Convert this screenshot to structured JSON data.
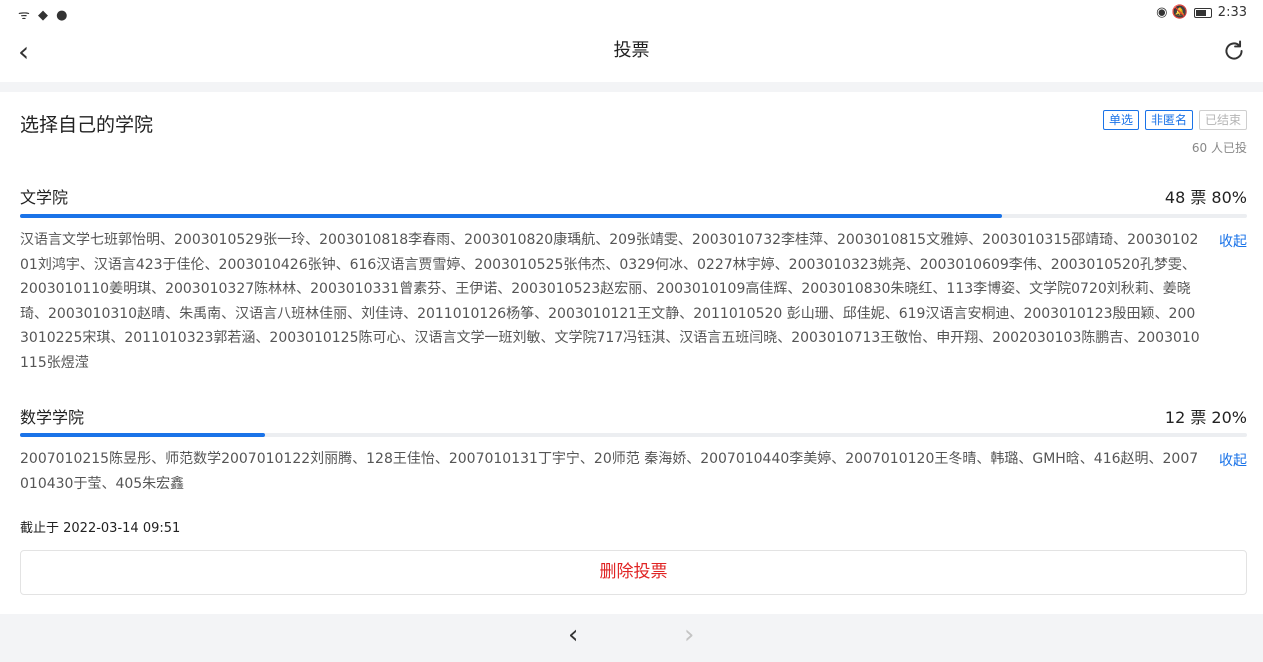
{
  "status_bar": {
    "left_icons": "ᯤ ◆ ●",
    "time": "2:33",
    "right_icons": "◉ 🔕"
  },
  "header": {
    "title": "投票",
    "back_icon": "‹"
  },
  "poll": {
    "question": "选择自己的学院",
    "tags": [
      "单选",
      "非匿名",
      "已结束"
    ],
    "voted_count": "60 人已投",
    "options": [
      {
        "name": "文学院",
        "stats": "48 票 80%",
        "percent": 80,
        "collapse_label": "收起",
        "voters": "汉语言文学七班郭怡明、2003010529张一玲、2003010818李春雨、2003010820康瑀航、209张靖雯、2003010732李桂萍、2003010815文雅婷、2003010315邵靖琦、2003010201刘鸿宇、汉语言423于佳伦、2003010426张钟、616汉语言贾雪婷、2003010525张伟杰、0329何冰、0227林宇婷、2003010323姚尧、2003010609李伟、2003010520孔梦雯、2003010110姜明琪、2003010327陈林林、2003010331曾素芬、王伊诺、2003010523赵宏丽、2003010109高佳辉、2003010830朱晓红、113李博姿、文学院0720刘秋莉、姜晓琦、2003010310赵晴、朱禹南、汉语言八班林佳丽、刘佳诗、2011010126杨筝、2003010121王文静、2011010520 彭山珊、邱佳妮、619汉语言安桐迪、2003010123殷田颖、2003010225宋琪、2011010323郭若涵、2003010125陈可心、汉语言文学一班刘敏、文学院717冯钰淇、汉语言五班闫晓、2003010713王敬怡、申开翔、2002030103陈鹏吉、2003010115张煜滢"
      },
      {
        "name": "数学学院",
        "stats": "12 票 20%",
        "percent": 20,
        "collapse_label": "收起",
        "voters": "2007010215陈昱彤、师范数学2007010122刘丽腾、128王佳怡、2007010131丁宇宁、20师范 秦海娇、2007010440李美婷、2007010120王冬晴、韩璐、GMH晗、416赵明、2007010430于莹、405朱宏鑫"
      }
    ],
    "deadline": "截止于 2022-03-14 09:51",
    "delete_label": "删除投票"
  },
  "bottom_nav": {
    "prev_icon": "‹",
    "next_icon": "›"
  },
  "colors": {
    "accent": "#1a73e8",
    "danger": "#e02424",
    "background": "#f3f4f6"
  }
}
